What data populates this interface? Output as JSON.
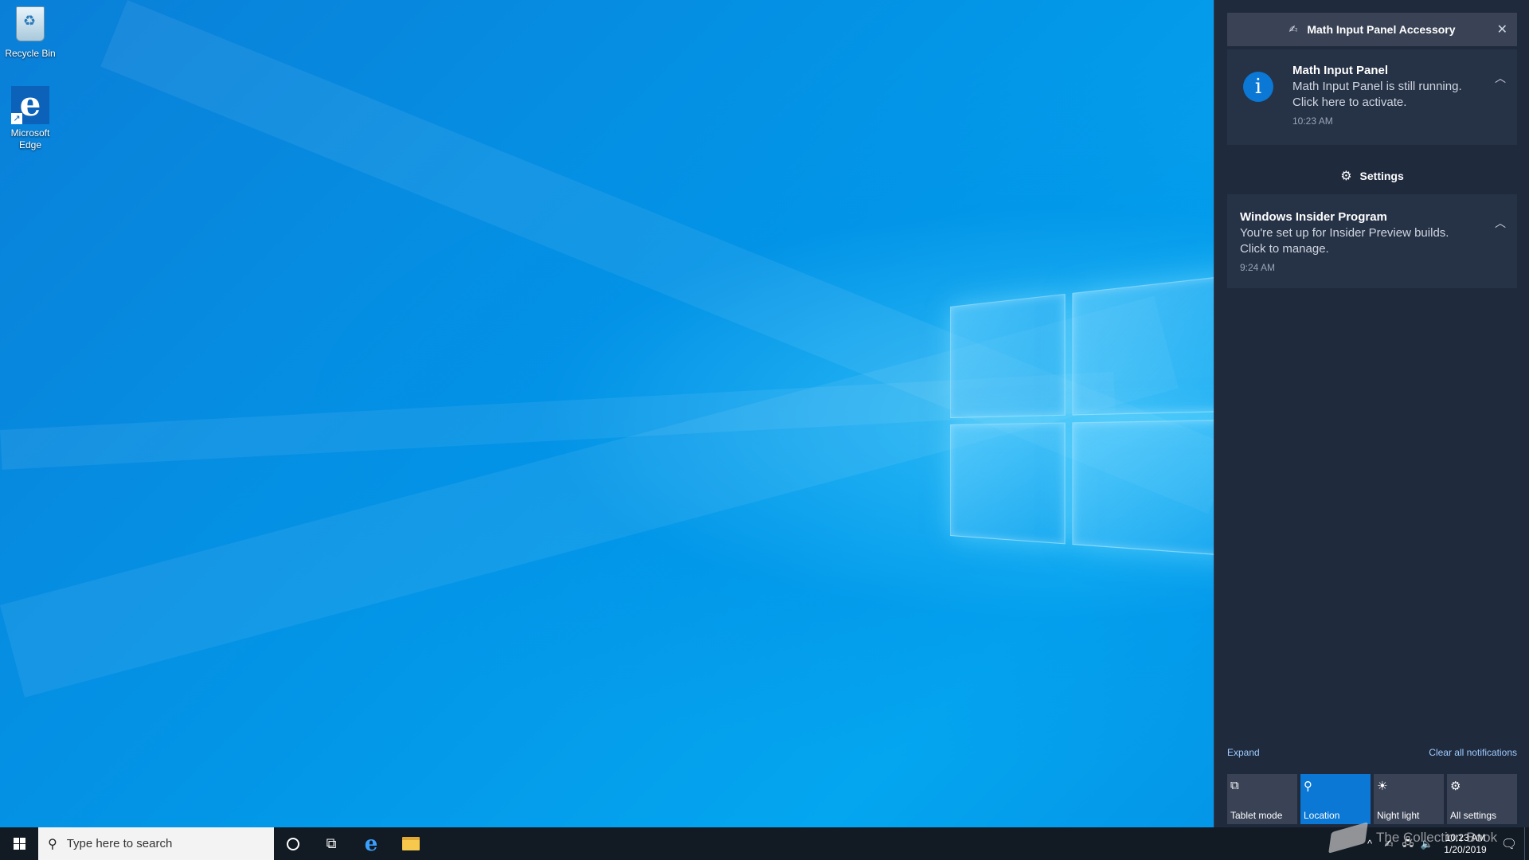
{
  "desktop": {
    "icons": [
      {
        "label": "Recycle Bin",
        "icon": "recycle-bin-icon"
      },
      {
        "label": "Microsoft Edge",
        "icon": "edge-icon"
      }
    ]
  },
  "action_center": {
    "app_group": {
      "title": "Math Input Panel Accessory",
      "icon": "math-input-panel-icon",
      "close_glyph": "✕"
    },
    "notifications": [
      {
        "title": "Math Input Panel",
        "body": "Math Input Panel is still running. Click here to activate.",
        "time": "10:23 AM",
        "icon_glyph": "i"
      }
    ],
    "settings_group": {
      "title": "Settings",
      "icon": "gear-icon",
      "icon_glyph": "⚙"
    },
    "settings_notifications": [
      {
        "title": "Windows Insider Program",
        "body": "You're set up for Insider Preview builds. Click to manage.",
        "time": "9:24 AM"
      }
    ],
    "expand_label": "Expand",
    "clear_all_label": "Clear all notifications",
    "quick_actions": [
      {
        "label": "Tablet mode",
        "icon": "tablet-mode-icon",
        "glyph": "⧉",
        "active": false
      },
      {
        "label": "Location",
        "icon": "location-icon",
        "glyph": "⚲",
        "active": true
      },
      {
        "label": "Night light",
        "icon": "night-light-icon",
        "glyph": "☀",
        "active": false
      },
      {
        "label": "All settings",
        "icon": "all-settings-icon",
        "glyph": "⚙",
        "active": false
      }
    ]
  },
  "taskbar": {
    "search_placeholder": "Type here to search",
    "search_glyph": "⚲",
    "task_view_glyph": "⧉",
    "edge_glyph": "e",
    "tray": {
      "chevron": "^",
      "time": "10:23 AM",
      "date": "1/20/2019",
      "notification_glyph": "🗨"
    }
  },
  "watermark": {
    "text": "The Collection Book"
  },
  "colors": {
    "accent": "#0a78d4",
    "action_center_bg": "#1f2a3c",
    "notification_card_bg": "#263246",
    "taskbar_bg": "#121a24",
    "link": "#9fcbff"
  }
}
